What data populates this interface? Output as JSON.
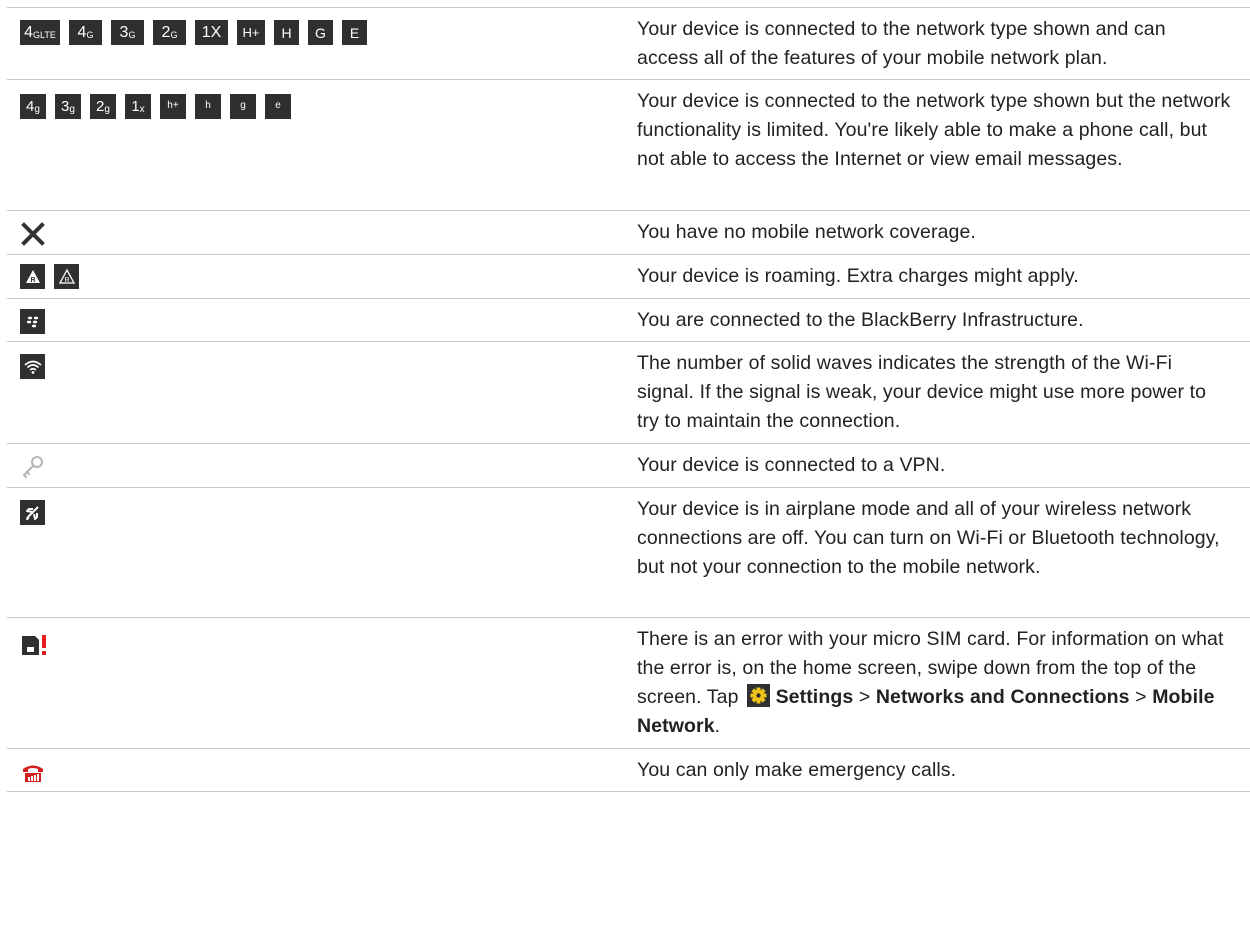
{
  "rows": [
    {
      "icons": [
        {
          "big": "4",
          "small": "GLTE",
          "name": "4g-lte-icon"
        },
        {
          "big": "4",
          "small": "G",
          "name": "4g-icon"
        },
        {
          "big": "3",
          "small": "G",
          "name": "3g-icon"
        },
        {
          "big": "2",
          "small": "G",
          "name": "2g-icon"
        },
        {
          "big": "1X",
          "small": "",
          "name": "1x-icon"
        },
        {
          "big": "H+",
          "small": "",
          "name": "hspa-plus-icon"
        },
        {
          "big": "H",
          "small": "",
          "name": "hspa-icon"
        },
        {
          "big": "G",
          "small": "",
          "name": "gprs-icon"
        },
        {
          "big": "E",
          "small": "",
          "name": "edge-icon"
        }
      ],
      "text": "Your device is connected to the network type shown and can access all of the features of your mobile network plan."
    },
    {
      "icons": [
        {
          "big": "4",
          "small": "g",
          "name": "4g-limited-icon"
        },
        {
          "big": "3",
          "small": "g",
          "name": "3g-limited-icon"
        },
        {
          "big": "2",
          "small": "g",
          "name": "2g-limited-icon"
        },
        {
          "big": "1",
          "small": "x",
          "name": "1x-limited-icon"
        },
        {
          "big": "",
          "small": "h+",
          "name": "hspa-plus-limited-icon"
        },
        {
          "big": "",
          "small": "h",
          "name": "hspa-limited-icon"
        },
        {
          "big": "",
          "small": "g",
          "name": "gprs-limited-icon"
        },
        {
          "big": "",
          "small": "e",
          "name": "edge-limited-icon"
        }
      ],
      "text": "Your device is connected to the network type shown but the network functionality is limited. You're likely able to make a phone call, but not able to access the Internet or view email messages."
    },
    {
      "text": "You have no mobile network coverage."
    },
    {
      "text": "Your device is roaming. Extra charges might apply."
    },
    {
      "text": "You are connected to the BlackBerry Infrastructure."
    },
    {
      "text": "The number of solid waves indicates the strength of the Wi-Fi signal. If the signal is weak, your device might use more power to try to maintain the connection."
    },
    {
      "text": "Your device is connected to a VPN."
    },
    {
      "text": "Your device is in airplane mode and all of your wireless network connections are off. You can turn on Wi-Fi or Bluetooth technology, but not your connection to the mobile network."
    },
    {
      "text_before": "There is an error with your micro SIM card. For information on what the error is, on the home screen, swipe down from the top of the screen. Tap",
      "settings": "Settings",
      "sep1": ">",
      "networks": "Networks and Connections",
      "sep2": ">",
      "mobile": "Mobile Network",
      "end": "."
    },
    {
      "text": "You can only make emergency calls."
    }
  ]
}
